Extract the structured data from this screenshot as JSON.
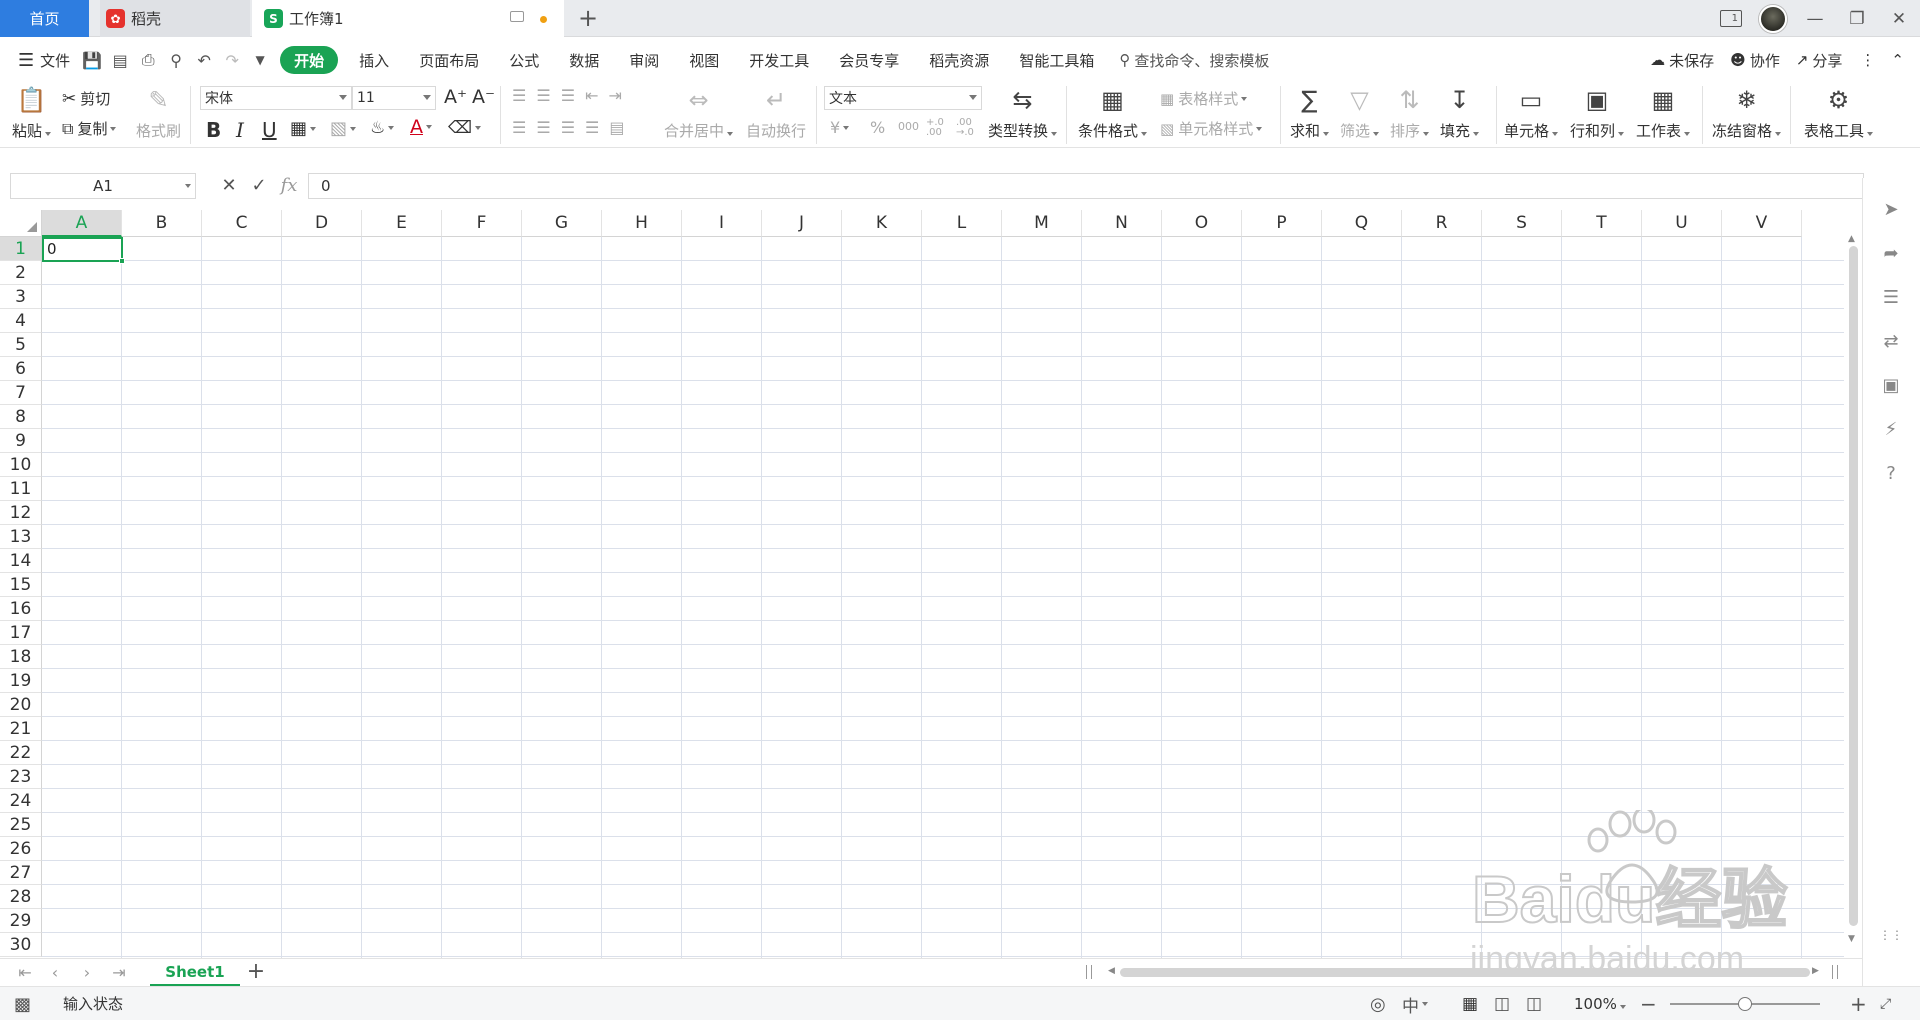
{
  "tabs": {
    "home": "首页",
    "daoke": "稻壳",
    "workbook": "工作簿1",
    "sheet_logo": "S"
  },
  "window": {
    "book_badge": "1"
  },
  "menu": {
    "file": "文件",
    "items": [
      "开始",
      "插入",
      "页面布局",
      "公式",
      "数据",
      "审阅",
      "视图",
      "开发工具",
      "会员专享",
      "稻壳资源",
      "智能工具箱"
    ],
    "search": "查找命令、搜索模板",
    "unsaved": "未保存",
    "collab": "协作",
    "share": "分享"
  },
  "ribbon": {
    "paste": "粘贴",
    "cut": "剪切",
    "copy": "复制",
    "format_painter": "格式刷",
    "font_name": "宋体",
    "font_size": "11",
    "merge_center": "合并居中",
    "auto_wrap": "自动换行",
    "number_format": "文本",
    "currency": "¥",
    "percent": "%",
    "thousands": "000",
    "dec_inc": "+.0 .00",
    "dec_dec": ".00 →.0",
    "type_convert": "类型转换",
    "conditional_format": "条件格式",
    "table_style": "表格样式",
    "cell_style": "单元格样式",
    "sum": "求和",
    "filter": "筛选",
    "sort": "排序",
    "fill": "填充",
    "cell": "单元格",
    "row_col": "行和列",
    "worksheet": "工作表",
    "freeze": "冻结窗格",
    "table_tools": "表格工具"
  },
  "formula_bar": {
    "name_box": "A1",
    "fx": "fx",
    "value": "0"
  },
  "grid": {
    "columns": [
      "A",
      "B",
      "C",
      "D",
      "E",
      "F",
      "G",
      "H",
      "I",
      "J",
      "K",
      "L",
      "M",
      "N",
      "O",
      "P",
      "Q",
      "R",
      "S",
      "T",
      "U",
      "V"
    ],
    "rows": [
      "1",
      "2",
      "3",
      "4",
      "5",
      "6",
      "7",
      "8",
      "9",
      "10",
      "11",
      "12",
      "13",
      "14",
      "15",
      "16",
      "17",
      "18",
      "19",
      "20",
      "21",
      "22",
      "23",
      "24",
      "25",
      "26",
      "27",
      "28",
      "29",
      "30"
    ],
    "active_cell": "A1",
    "active_cell_value": "0"
  },
  "sheets": {
    "tabs": [
      "Sheet1"
    ],
    "active": "Sheet1"
  },
  "status": {
    "mode": "输入状态",
    "zoom": "100%",
    "zoom_fraction": 0.5
  },
  "watermark": {
    "brand": "Baidu经验",
    "url": "jingyan.baidu.com"
  },
  "colors": {
    "accent": "#1aa354",
    "home_tab": "#2e7de0",
    "daoke_logo": "#e5322d",
    "unsaved_dot": "#f0a012"
  }
}
